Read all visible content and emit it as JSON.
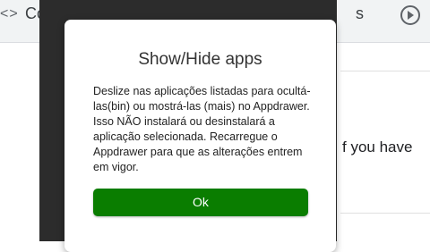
{
  "background": {
    "nav_arrows": "<>",
    "title_left": "Co",
    "title_right": "s",
    "partial_text": "f you have"
  },
  "dialog": {
    "title": "Show/Hide apps",
    "message": "Deslize nas aplicações listadas para ocultá-las(bin) ou mostrá-las (mais) no Appdrawer. Isso NÃO instalará ou desinstalará a aplicação selecionada. Recarregue o Appdrawer para que as alterações entrem em vigor.",
    "ok_label": "Ok"
  },
  "colors": {
    "ok_button": "#0a7d00",
    "app_frame": "#2c2c2c"
  },
  "icons": [
    "back-forward-arrows-icon",
    "play-circle-icon"
  ]
}
